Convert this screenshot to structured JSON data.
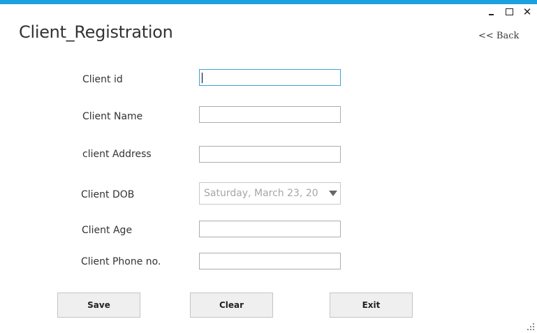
{
  "window": {
    "title": "Client_Registration",
    "back_label": "<< Back",
    "controls": {
      "minimize_icon": "minimize-icon",
      "maximize_icon": "maximize-icon",
      "close_glyph": "✕"
    },
    "accent_color": "#1ba1e2"
  },
  "form": {
    "client_id": {
      "label": "Client id",
      "value": ""
    },
    "client_name": {
      "label": "Client Name",
      "value": ""
    },
    "client_address": {
      "label": "client Address",
      "value": ""
    },
    "client_dob": {
      "label": "Client DOB",
      "value": "Saturday, March 23, 20"
    },
    "client_age": {
      "label": "Client Age",
      "value": ""
    },
    "client_phone": {
      "label": "Client Phone no.",
      "value": ""
    }
  },
  "actions": {
    "save_label": "Save",
    "clear_label": "Clear",
    "exit_label": "Exit"
  }
}
